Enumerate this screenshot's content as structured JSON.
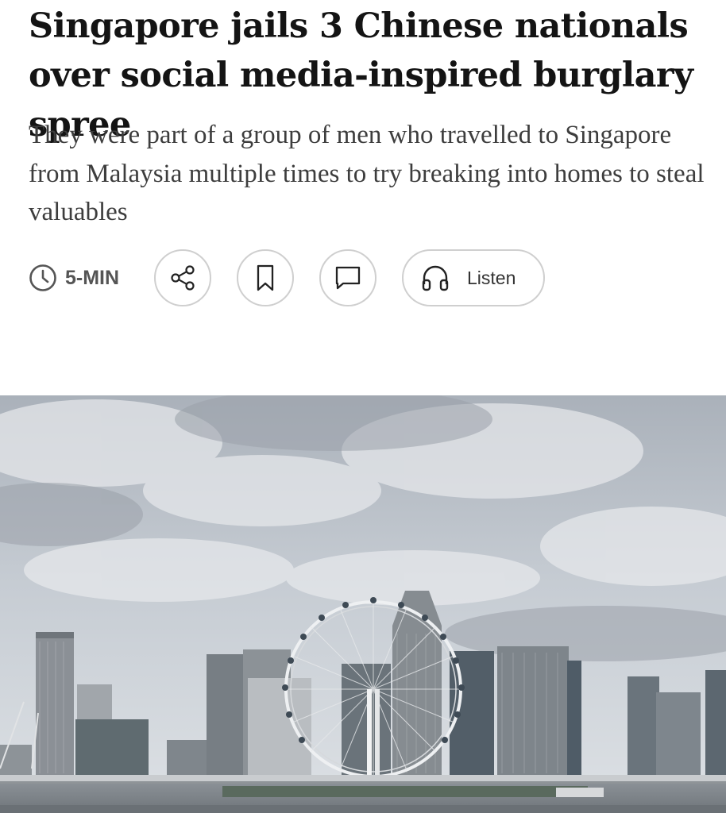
{
  "article": {
    "headline": "Singapore jails 3 Chinese nationals over social media-inspired burglary spree",
    "standfirst": "They were part of a group of men who travelled to Singapore from Malaysia multiple times to try breaking into homes to steal valuables"
  },
  "toolbar": {
    "read_time": "5-MIN",
    "listen_label": "Listen",
    "icons": {
      "clock": "clock-icon",
      "share": "share-icon",
      "bookmark": "bookmark-icon",
      "comment": "comment-icon",
      "listen": "headphones-icon"
    }
  },
  "colors": {
    "headline": "#141414",
    "standfirst": "#3d3d3d",
    "button_border": "#cfcfcf",
    "sky": "#c9cfd6"
  }
}
